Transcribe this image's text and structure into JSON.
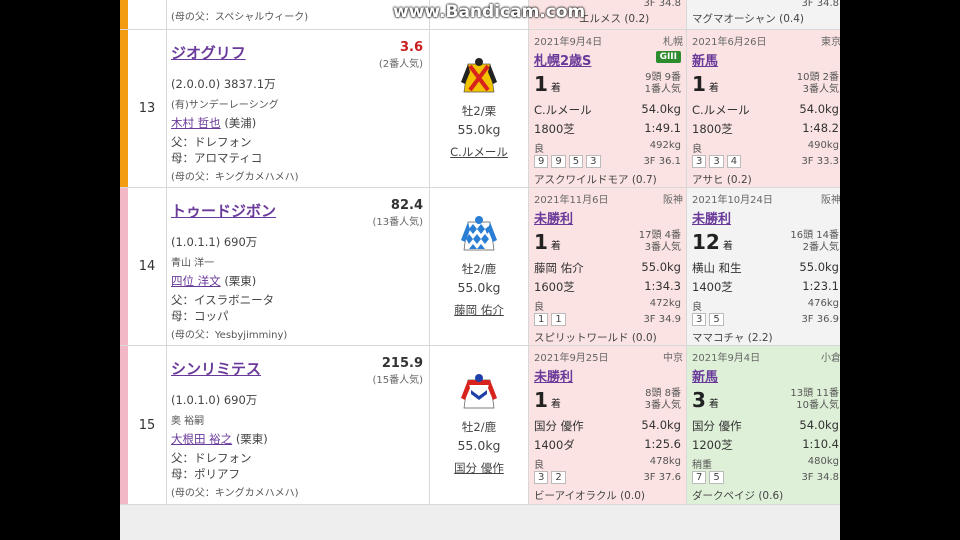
{
  "watermark": "www.Bandicam.com",
  "top_partial": {
    "sire_line": "(母の父：スペシャルウィーク)",
    "prev1_winner": "エルメス (0.2)",
    "prev1_f3": "3F 34.8",
    "prev2_winner": "マグマオーシャン (0.4)",
    "prev2_f3": "3F 34.8"
  },
  "colors": {
    "waku7": "#f39c12",
    "waku8": "#f2b8c6",
    "fav_odds": "#c8201e",
    "link": "#6a3a9a",
    "grade_bg": "#2e8b2e"
  },
  "horses": [
    {
      "number": "13",
      "name": "ジオグリフ",
      "odds": "3.6",
      "popularity": "(2番人気)",
      "record": "(2.0.0.0) 3837.1万",
      "owner": "(有)サンデーレーシング",
      "trainer": "木村 哲也",
      "trainer_stable": "(美浦)",
      "sire": "父：ドレフォン",
      "dam": "母：アロマティコ",
      "damsire": "(母の父：キングカメハメハ)",
      "sex_age": "牡2/栗",
      "weight": "55.0kg",
      "jockey": "C.ルメール",
      "silk_icon": "silk-yellow-red-cross",
      "races": [
        {
          "date": "2021年9月4日",
          "place": "札幌",
          "name": "札幌2歳S",
          "grade": "GIII",
          "rank": "1",
          "rank_unit": "着",
          "field": "9頭 9番",
          "field_pop": "1番人気",
          "jockey": "C.ルメール",
          "weight": "54.0kg",
          "distance": "1800芝",
          "time": "1:49.1",
          "cond": "良",
          "bw": "492kg",
          "passing": [
            "9",
            "9",
            "5",
            "3"
          ],
          "f3": "3F 36.1",
          "winner": "アスクワイルドモア (0.7)"
        },
        {
          "date": "2021年6月26日",
          "place": "東京",
          "name": "新馬",
          "grade": "",
          "rank": "1",
          "rank_unit": "着",
          "field": "10頭 2番",
          "field_pop": "3番人気",
          "jockey": "C.ルメール",
          "weight": "54.0kg",
          "distance": "1800芝",
          "time": "1:48.2",
          "cond": "良",
          "bw": "490kg",
          "passing": [
            "3",
            "3",
            "4"
          ],
          "f3": "3F 33.3",
          "winner": "アサヒ (0.2)"
        }
      ]
    },
    {
      "number": "14",
      "name": "トゥードジボン",
      "odds": "82.4",
      "popularity": "(13番人気)",
      "record": "(1.0.1.1) 690万",
      "owner": "青山 洋一",
      "trainer": "四位 洋文",
      "trainer_stable": "(栗東)",
      "sire": "父：イスラボニータ",
      "dam": "母：コッパ",
      "damsire": "(母の父：Yesbyjimminy)",
      "sex_age": "牡2/鹿",
      "weight": "55.0kg",
      "jockey": "藤岡 佑介",
      "silk_icon": "silk-blue-diamonds",
      "races": [
        {
          "date": "2021年11月6日",
          "place": "阪神",
          "name": "未勝利",
          "grade": "",
          "rank": "1",
          "rank_unit": "着",
          "field": "17頭 4番",
          "field_pop": "3番人気",
          "jockey": "藤岡 佑介",
          "weight": "55.0kg",
          "distance": "1600芝",
          "time": "1:34.3",
          "cond": "良",
          "bw": "472kg",
          "passing": [
            "1",
            "1"
          ],
          "f3": "3F 34.9",
          "winner": "スピリットワールド (0.0)"
        },
        {
          "date": "2021年10月24日",
          "place": "阪神",
          "name": "未勝利",
          "grade": "",
          "rank": "12",
          "rank_unit": "着",
          "field": "16頭 14番",
          "field_pop": "2番人気",
          "jockey": "横山 和生",
          "weight": "55.0kg",
          "distance": "1400芝",
          "time": "1:23.1",
          "cond": "良",
          "bw": "476kg",
          "passing": [
            "3",
            "5"
          ],
          "f3": "3F 36.9",
          "winner": "ママコチャ (2.2)"
        }
      ]
    },
    {
      "number": "15",
      "name": "シンリミテス",
      "odds": "215.9",
      "popularity": "(15番人気)",
      "record": "(1.0.1.0) 690万",
      "owner": "奥 裕嗣",
      "trainer": "大根田 裕之",
      "trainer_stable": "(栗東)",
      "sire": "父：ドレフォン",
      "dam": "母：ポリアフ",
      "damsire": "(母の父：キングカメハメハ)",
      "sex_age": "牡2/鹿",
      "weight": "55.0kg",
      "jockey": "国分 優作",
      "silk_icon": "silk-red-white-blue",
      "races": [
        {
          "date": "2021年9月25日",
          "place": "中京",
          "name": "未勝利",
          "grade": "",
          "rank": "1",
          "rank_unit": "着",
          "field": "8頭 8番",
          "field_pop": "3番人気",
          "jockey": "国分 優作",
          "weight": "54.0kg",
          "distance": "1400ダ",
          "time": "1:25.6",
          "cond": "良",
          "bw": "478kg",
          "passing": [
            "3",
            "2"
          ],
          "f3": "3F 37.6",
          "winner": "ビーアイオラクル (0.0)"
        },
        {
          "date": "2021年9月4日",
          "place": "小倉",
          "name": "新馬",
          "grade": "",
          "rank": "3",
          "rank_unit": "着",
          "field": "13頭 11番",
          "field_pop": "10番人気",
          "jockey": "国分 優作",
          "weight": "54.0kg",
          "distance": "1200芝",
          "time": "1:10.4",
          "cond": "稍重",
          "bw": "480kg",
          "passing": [
            "7",
            "5"
          ],
          "f3": "3F 34.8",
          "winner": "ダークペイジ (0.6)"
        }
      ]
    }
  ]
}
